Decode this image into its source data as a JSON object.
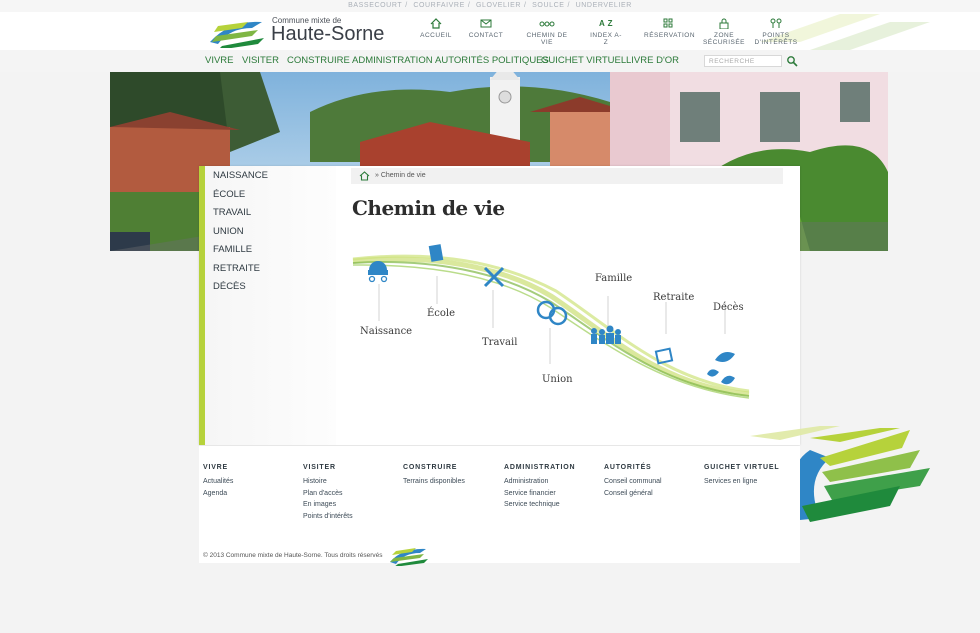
{
  "villages": [
    "BASSECOURT",
    "COURFAIVRE",
    "GLOVELIER",
    "SOULCE",
    "UNDERVELIER"
  ],
  "logo": {
    "small": "Commune mixte de",
    "big": "Haute-Sorne"
  },
  "topnav": [
    {
      "label": "ACCUEIL",
      "icon": "home-icon"
    },
    {
      "label": "CONTACT",
      "icon": "mail-icon"
    },
    {
      "label": "CHEMIN DE VIE",
      "icon": "path-icon"
    },
    {
      "label": "INDEX A-Z",
      "icon": "az-icon",
      "glyph": "A Z"
    },
    {
      "label": "RÉSERVATION",
      "icon": "grid-icon"
    },
    {
      "label": "ZONE",
      "label2": "SÉCURISÉE",
      "icon": "lock-icon"
    },
    {
      "label": "POINTS",
      "label2": "D'INTÉRÊTS",
      "icon": "poi-icon"
    }
  ],
  "menu": [
    "VIVRE",
    "VISITER",
    "CONSTRUIRE",
    "ADMINISTRATION",
    "AUTORITÉS POLITIQUES",
    "GUICHET VIRTUEL",
    "LIVRE D'OR"
  ],
  "search": {
    "placeholder": "RECHERCHE"
  },
  "sidebar": [
    "NAISSANCE",
    "ÉCOLE",
    "TRAVAIL",
    "UNION",
    "FAMILLE",
    "RETRAITE",
    "DÉCÈS"
  ],
  "breadcrumb": {
    "text": "» Chemin de vie"
  },
  "page_title": "Chemin de vie",
  "life_stages": [
    "Naissance",
    "École",
    "Travail",
    "Union",
    "Famille",
    "Retraite",
    "Décès"
  ],
  "footer": [
    {
      "heading": "VIVRE",
      "links": [
        "Actualités",
        "Agenda"
      ]
    },
    {
      "heading": "VISITER",
      "links": [
        "Histoire",
        "Plan d'accès",
        "En images",
        "Points d'intérêts"
      ]
    },
    {
      "heading": "CONSTRUIRE",
      "links": [
        "Terrains disponibles"
      ]
    },
    {
      "heading": "ADMINISTRATION",
      "links": [
        "Administration",
        "Service financier",
        "Service technique"
      ]
    },
    {
      "heading": "AUTORITÉS",
      "links": [
        "Conseil communal",
        "Conseil général"
      ]
    },
    {
      "heading": "GUICHET VIRTUEL",
      "links": [
        "Services en ligne"
      ]
    }
  ],
  "copyright": "© 2013 Commune mixte de Haute-Sorne. Tous droits réservés",
  "colors": {
    "menu_green": "#2c7a3a",
    "accent_lime": "#b6d23b",
    "icon_blue": "#2f86c6",
    "dark_green": "#1f8a3c"
  }
}
